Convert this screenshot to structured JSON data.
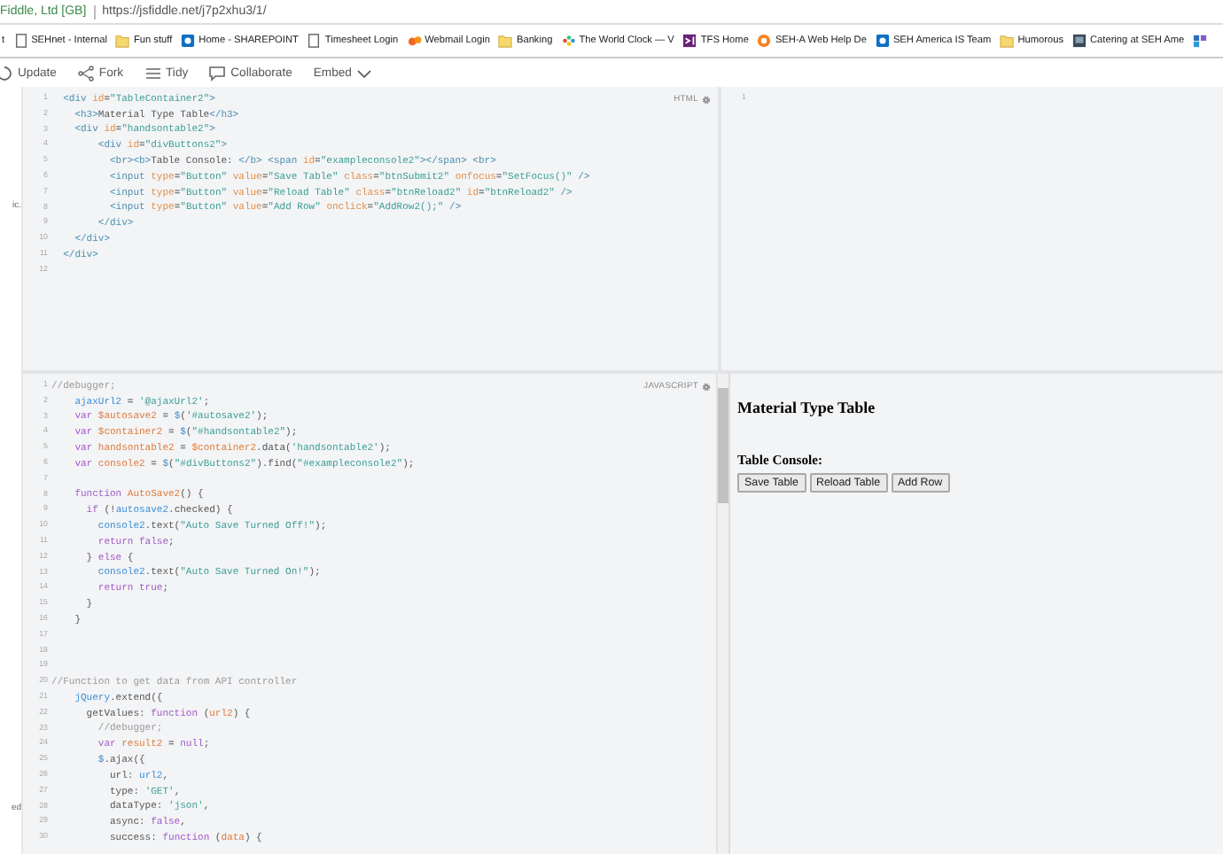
{
  "address_bar": {
    "site_identity": "Fiddle, Ltd [GB]",
    "url": "https://jsfiddle.net/j7p2xhu3/1/"
  },
  "bookmarks": [
    {
      "label": "t"
    },
    {
      "kind": "page",
      "label": "SEHnet - Internal"
    },
    {
      "kind": "folder",
      "label": "Fun stuff"
    },
    {
      "kind": "sharepoint",
      "label": "Home - SHAREPOINT"
    },
    {
      "kind": "page",
      "label": "Timesheet Login"
    },
    {
      "kind": "webmail",
      "label": "Webmail Login"
    },
    {
      "kind": "folder",
      "label": "Banking"
    },
    {
      "kind": "clock",
      "label": "The World Clock — V"
    },
    {
      "kind": "vs",
      "label": "TFS Home"
    },
    {
      "kind": "help",
      "label": "SEH-A Web Help De"
    },
    {
      "kind": "sharepoint",
      "label": "SEH America IS Team"
    },
    {
      "kind": "folder",
      "label": "Humorous"
    },
    {
      "kind": "photo",
      "label": "Catering at SEH Ame"
    },
    {
      "kind": "tiles"
    }
  ],
  "toolbar": [
    {
      "kind": "update",
      "label": "Update"
    },
    {
      "kind": "fork",
      "label": "Fork"
    },
    {
      "kind": "tidy",
      "label": "Tidy"
    },
    {
      "kind": "collaborate",
      "label": "Collaborate"
    },
    {
      "kind": "dropdown",
      "label": "Embed"
    }
  ],
  "sidebar": {
    "text_top": "ic.",
    "text_bottom": "ed"
  },
  "html_panel": {
    "label": "HTML",
    "lines": [
      {
        "number": "1",
        "tokens": [
          {
            "kind": "tag",
            "text": "  <div"
          },
          {
            "kind": "attr",
            "text": " id"
          },
          {
            "kind": "p",
            "text": "="
          },
          {
            "kind": "str",
            "text": "\"TableContainer2\""
          },
          {
            "kind": "tag",
            "text": ">"
          }
        ]
      },
      {
        "number": "2",
        "tokens": [
          {
            "kind": "tag",
            "text": "    <h3>"
          },
          {
            "kind": "p",
            "text": "Material Type Table"
          },
          {
            "kind": "tag",
            "text": "</h3>"
          }
        ]
      },
      {
        "number": "3",
        "tokens": [
          {
            "kind": "tag",
            "text": "    <div"
          },
          {
            "kind": "attr",
            "text": " id"
          },
          {
            "kind": "p",
            "text": "="
          },
          {
            "kind": "str",
            "text": "\"handsontable2\""
          },
          {
            "kind": "tag",
            "text": ">"
          }
        ]
      },
      {
        "number": "4",
        "tokens": [
          {
            "kind": "tag",
            "text": "        <div"
          },
          {
            "kind": "attr",
            "text": " id"
          },
          {
            "kind": "p",
            "text": "="
          },
          {
            "kind": "str",
            "text": "\"divButtons2\""
          },
          {
            "kind": "tag",
            "text": ">"
          }
        ]
      },
      {
        "number": "5",
        "tokens": [
          {
            "kind": "tag",
            "text": "          <br><b>"
          },
          {
            "kind": "p",
            "text": "Table Console: "
          },
          {
            "kind": "tag",
            "text": "</b> <span"
          },
          {
            "kind": "attr",
            "text": " id"
          },
          {
            "kind": "p",
            "text": "="
          },
          {
            "kind": "str",
            "text": "\"exampleconsole2\""
          },
          {
            "kind": "tag",
            "text": "></span> <br>"
          }
        ]
      },
      {
        "number": "6",
        "tokens": [
          {
            "kind": "tag",
            "text": "          <input"
          },
          {
            "kind": "attr",
            "text": " type"
          },
          {
            "kind": "p",
            "text": "="
          },
          {
            "kind": "str",
            "text": "\"Button\""
          },
          {
            "kind": "attr",
            "text": " value"
          },
          {
            "kind": "p",
            "text": "="
          },
          {
            "kind": "str",
            "text": "\"Save Table\""
          },
          {
            "kind": "attr",
            "text": " class"
          },
          {
            "kind": "p",
            "text": "="
          },
          {
            "kind": "str",
            "text": "\"btnSubmit2\""
          },
          {
            "kind": "attr",
            "text": " onfocus"
          },
          {
            "kind": "p",
            "text": "="
          },
          {
            "kind": "str",
            "text": "\"SetFocus()\""
          },
          {
            "kind": "tag",
            "text": " />"
          }
        ]
      },
      {
        "number": "7",
        "tokens": [
          {
            "kind": "tag",
            "text": "          <input"
          },
          {
            "kind": "attr",
            "text": " type"
          },
          {
            "kind": "p",
            "text": "="
          },
          {
            "kind": "str",
            "text": "\"Button\""
          },
          {
            "kind": "attr",
            "text": " value"
          },
          {
            "kind": "p",
            "text": "="
          },
          {
            "kind": "str",
            "text": "\"Reload Table\""
          },
          {
            "kind": "attr",
            "text": " class"
          },
          {
            "kind": "p",
            "text": "="
          },
          {
            "kind": "str",
            "text": "\"btnReload2\""
          },
          {
            "kind": "attr",
            "text": " id"
          },
          {
            "kind": "p",
            "text": "="
          },
          {
            "kind": "str",
            "text": "\"btnReload2\""
          },
          {
            "kind": "tag",
            "text": " />"
          }
        ]
      },
      {
        "number": "8",
        "tokens": [
          {
            "kind": "tag",
            "text": "          <input"
          },
          {
            "kind": "attr",
            "text": " type"
          },
          {
            "kind": "p",
            "text": "="
          },
          {
            "kind": "str",
            "text": "\"Button\""
          },
          {
            "kind": "attr",
            "text": " value"
          },
          {
            "kind": "p",
            "text": "="
          },
          {
            "kind": "str",
            "text": "\"Add Row\""
          },
          {
            "kind": "attr",
            "text": " onclick"
          },
          {
            "kind": "p",
            "text": "="
          },
          {
            "kind": "str",
            "text": "\"AddRow2();\""
          },
          {
            "kind": "tag",
            "text": " />"
          }
        ]
      },
      {
        "number": "9",
        "tokens": [
          {
            "kind": "tag",
            "text": "        </div>"
          }
        ]
      },
      {
        "number": "10",
        "tokens": [
          {
            "kind": "tag",
            "text": "    </div>"
          }
        ]
      },
      {
        "number": "11",
        "tokens": [
          {
            "kind": "tag",
            "text": "  </div>"
          }
        ]
      },
      {
        "number": "12"
      }
    ]
  },
  "css_panel": {
    "lines": [
      {
        "number": "1"
      }
    ]
  },
  "js_panel": {
    "label": "JAVASCRIPT",
    "lines": [
      {
        "number": "1",
        "tokens": [
          {
            "kind": "cm",
            "text": "//debugger;"
          }
        ]
      },
      {
        "number": "2",
        "tokens": [
          {
            "kind": "def",
            "text": "    ajaxUrl2"
          },
          {
            "kind": "p",
            "text": " = "
          },
          {
            "kind": "str",
            "text": "'@ajaxUrl2'"
          },
          {
            "kind": "p",
            "text": ";"
          }
        ]
      },
      {
        "number": "3",
        "tokens": [
          {
            "kind": "kw",
            "text": "    var"
          },
          {
            "kind": "var",
            "text": " $autosave2"
          },
          {
            "kind": "p",
            "text": " = "
          },
          {
            "kind": "def",
            "text": "$"
          },
          {
            "kind": "p",
            "text": "("
          },
          {
            "kind": "str",
            "text": "'#autosave2'"
          },
          {
            "kind": "p",
            "text": ");"
          }
        ]
      },
      {
        "number": "4",
        "tokens": [
          {
            "kind": "kw",
            "text": "    var"
          },
          {
            "kind": "var",
            "text": " $container2"
          },
          {
            "kind": "p",
            "text": " = "
          },
          {
            "kind": "def",
            "text": "$"
          },
          {
            "kind": "p",
            "text": "("
          },
          {
            "kind": "str",
            "text": "\"#handsontable2\""
          },
          {
            "kind": "p",
            "text": ");"
          }
        ]
      },
      {
        "number": "5",
        "tokens": [
          {
            "kind": "kw",
            "text": "    var"
          },
          {
            "kind": "var",
            "text": " handsontable2"
          },
          {
            "kind": "p",
            "text": " = "
          },
          {
            "kind": "var",
            "text": "$container2"
          },
          {
            "kind": "p",
            "text": ".data("
          },
          {
            "kind": "str",
            "text": "'handsontable2'"
          },
          {
            "kind": "p",
            "text": ");"
          }
        ]
      },
      {
        "number": "6",
        "tokens": [
          {
            "kind": "kw",
            "text": "    var"
          },
          {
            "kind": "var",
            "text": " console2"
          },
          {
            "kind": "p",
            "text": " = "
          },
          {
            "kind": "def",
            "text": "$"
          },
          {
            "kind": "p",
            "text": "("
          },
          {
            "kind": "str",
            "text": "\"#divButtons2\""
          },
          {
            "kind": "p",
            "text": ").find("
          },
          {
            "kind": "str",
            "text": "\"#exampleconsole2\""
          },
          {
            "kind": "p",
            "text": ");"
          }
        ]
      },
      {
        "number": "7"
      },
      {
        "number": "8",
        "tokens": [
          {
            "kind": "kw",
            "text": "    function"
          },
          {
            "kind": "var",
            "text": " AutoSave2"
          },
          {
            "kind": "p",
            "text": "() {"
          }
        ]
      },
      {
        "number": "9",
        "tokens": [
          {
            "kind": "kw",
            "text": "      if"
          },
          {
            "kind": "p",
            "text": " (!"
          },
          {
            "kind": "def",
            "text": "autosave2"
          },
          {
            "kind": "p",
            "text": ".checked) {"
          }
        ]
      },
      {
        "number": "10",
        "tokens": [
          {
            "kind": "def",
            "text": "        console2"
          },
          {
            "kind": "p",
            "text": ".text("
          },
          {
            "kind": "str",
            "text": "\"Auto Save Turned Off!\""
          },
          {
            "kind": "p",
            "text": ");"
          }
        ]
      },
      {
        "number": "11",
        "tokens": [
          {
            "kind": "kw",
            "text": "        return"
          },
          {
            "kind": "kw",
            "text": " false"
          },
          {
            "kind": "p",
            "text": ";"
          }
        ]
      },
      {
        "number": "12",
        "tokens": [
          {
            "kind": "p",
            "text": "      } "
          },
          {
            "kind": "kw",
            "text": "else"
          },
          {
            "kind": "p",
            "text": " {"
          }
        ]
      },
      {
        "number": "13",
        "tokens": [
          {
            "kind": "def",
            "text": "        console2"
          },
          {
            "kind": "p",
            "text": ".text("
          },
          {
            "kind": "str",
            "text": "\"Auto Save Turned On!\""
          },
          {
            "kind": "p",
            "text": ");"
          }
        ]
      },
      {
        "number": "14",
        "tokens": [
          {
            "kind": "kw",
            "text": "        return"
          },
          {
            "kind": "kw",
            "text": " true"
          },
          {
            "kind": "p",
            "text": ";"
          }
        ]
      },
      {
        "number": "15",
        "tokens": [
          {
            "kind": "p",
            "text": "      }"
          }
        ]
      },
      {
        "number": "16",
        "tokens": [
          {
            "kind": "p",
            "text": "    }"
          }
        ]
      },
      {
        "number": "17"
      },
      {
        "number": "18"
      },
      {
        "number": "19"
      },
      {
        "number": "20",
        "tokens": [
          {
            "kind": "cm",
            "text": "//Function to get data from API controller"
          }
        ]
      },
      {
        "number": "21",
        "tokens": [
          {
            "kind": "def",
            "text": "    jQuery"
          },
          {
            "kind": "p",
            "text": ".extend({"
          }
        ]
      },
      {
        "number": "22",
        "tokens": [
          {
            "kind": "p",
            "text": "      getValues: "
          },
          {
            "kind": "kw",
            "text": "function"
          },
          {
            "kind": "p",
            "text": " ("
          },
          {
            "kind": "var",
            "text": "url2"
          },
          {
            "kind": "p",
            "text": ") {"
          }
        ]
      },
      {
        "number": "23",
        "tokens": [
          {
            "kind": "cm",
            "text": "        //debugger;"
          }
        ]
      },
      {
        "number": "24",
        "tokens": [
          {
            "kind": "kw",
            "text": "        var"
          },
          {
            "kind": "var",
            "text": " result2"
          },
          {
            "kind": "p",
            "text": " = "
          },
          {
            "kind": "kw",
            "text": "null"
          },
          {
            "kind": "p",
            "text": ";"
          }
        ]
      },
      {
        "number": "25",
        "tokens": [
          {
            "kind": "def",
            "text": "        $"
          },
          {
            "kind": "p",
            "text": ".ajax({"
          }
        ]
      },
      {
        "number": "26",
        "tokens": [
          {
            "kind": "p",
            "text": "          url: "
          },
          {
            "kind": "def",
            "text": "url2"
          },
          {
            "kind": "p",
            "text": ","
          }
        ]
      },
      {
        "number": "27",
        "tokens": [
          {
            "kind": "p",
            "text": "          type: "
          },
          {
            "kind": "str",
            "text": "'GET'"
          },
          {
            "kind": "p",
            "text": ","
          }
        ]
      },
      {
        "number": "28",
        "tokens": [
          {
            "kind": "p",
            "text": "          dataType: "
          },
          {
            "kind": "str",
            "text": "'json'"
          },
          {
            "kind": "p",
            "text": ","
          }
        ]
      },
      {
        "number": "29",
        "tokens": [
          {
            "kind": "p",
            "text": "          async: "
          },
          {
            "kind": "kw",
            "text": "false"
          },
          {
            "kind": "p",
            "text": ","
          }
        ]
      },
      {
        "number": "30",
        "tokens": [
          {
            "kind": "p",
            "text": "          success: "
          },
          {
            "kind": "kw",
            "text": "function"
          },
          {
            "kind": "p",
            "text": " ("
          },
          {
            "kind": "var",
            "text": "data"
          },
          {
            "kind": "p",
            "text": ") {"
          }
        ]
      }
    ]
  },
  "result": {
    "heading": "Material Type Table",
    "console_label": "Table Console:",
    "buttons": [
      "Save Table",
      "Reload Table",
      "Add Row"
    ]
  }
}
